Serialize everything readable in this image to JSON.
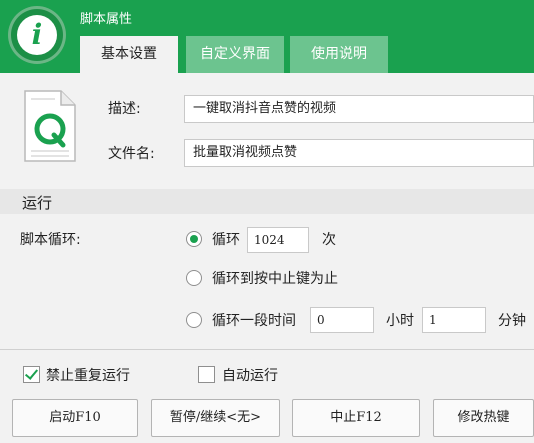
{
  "window": {
    "title": "脚本属性"
  },
  "tabs": [
    {
      "label": "基本设置",
      "active": true
    },
    {
      "label": "自定义界面",
      "active": false
    },
    {
      "label": "使用说明",
      "active": false
    }
  ],
  "file": {
    "description_label": "描述:",
    "description_value": "一键取消抖音点赞的视频",
    "filename_label": "文件名:",
    "filename_value": "批量取消视频点赞"
  },
  "run": {
    "section_title": "运行",
    "loop_label": "脚本循环:",
    "options": {
      "loop": {
        "label": "循环",
        "value": "1024",
        "unit": "次",
        "selected": true
      },
      "until_stop": {
        "label": "循环到按中止键为止",
        "selected": false
      },
      "duration": {
        "label": "循环一段时间",
        "hours_value": "0",
        "hours_unit": "小时",
        "minutes_value": "1",
        "minutes_unit": "分钟",
        "selected": false
      }
    }
  },
  "checks": {
    "no_repeat": {
      "label": "禁止重复运行",
      "checked": true
    },
    "auto_run": {
      "label": "自动运行",
      "checked": false
    }
  },
  "buttons": {
    "start": "启动F10",
    "pause": "暂停/继续<无>",
    "stop": "中止F12",
    "hotkey": "修改热键"
  },
  "colors": {
    "accent": "#1aa14f",
    "tab_inactive": "#6cc48f"
  }
}
